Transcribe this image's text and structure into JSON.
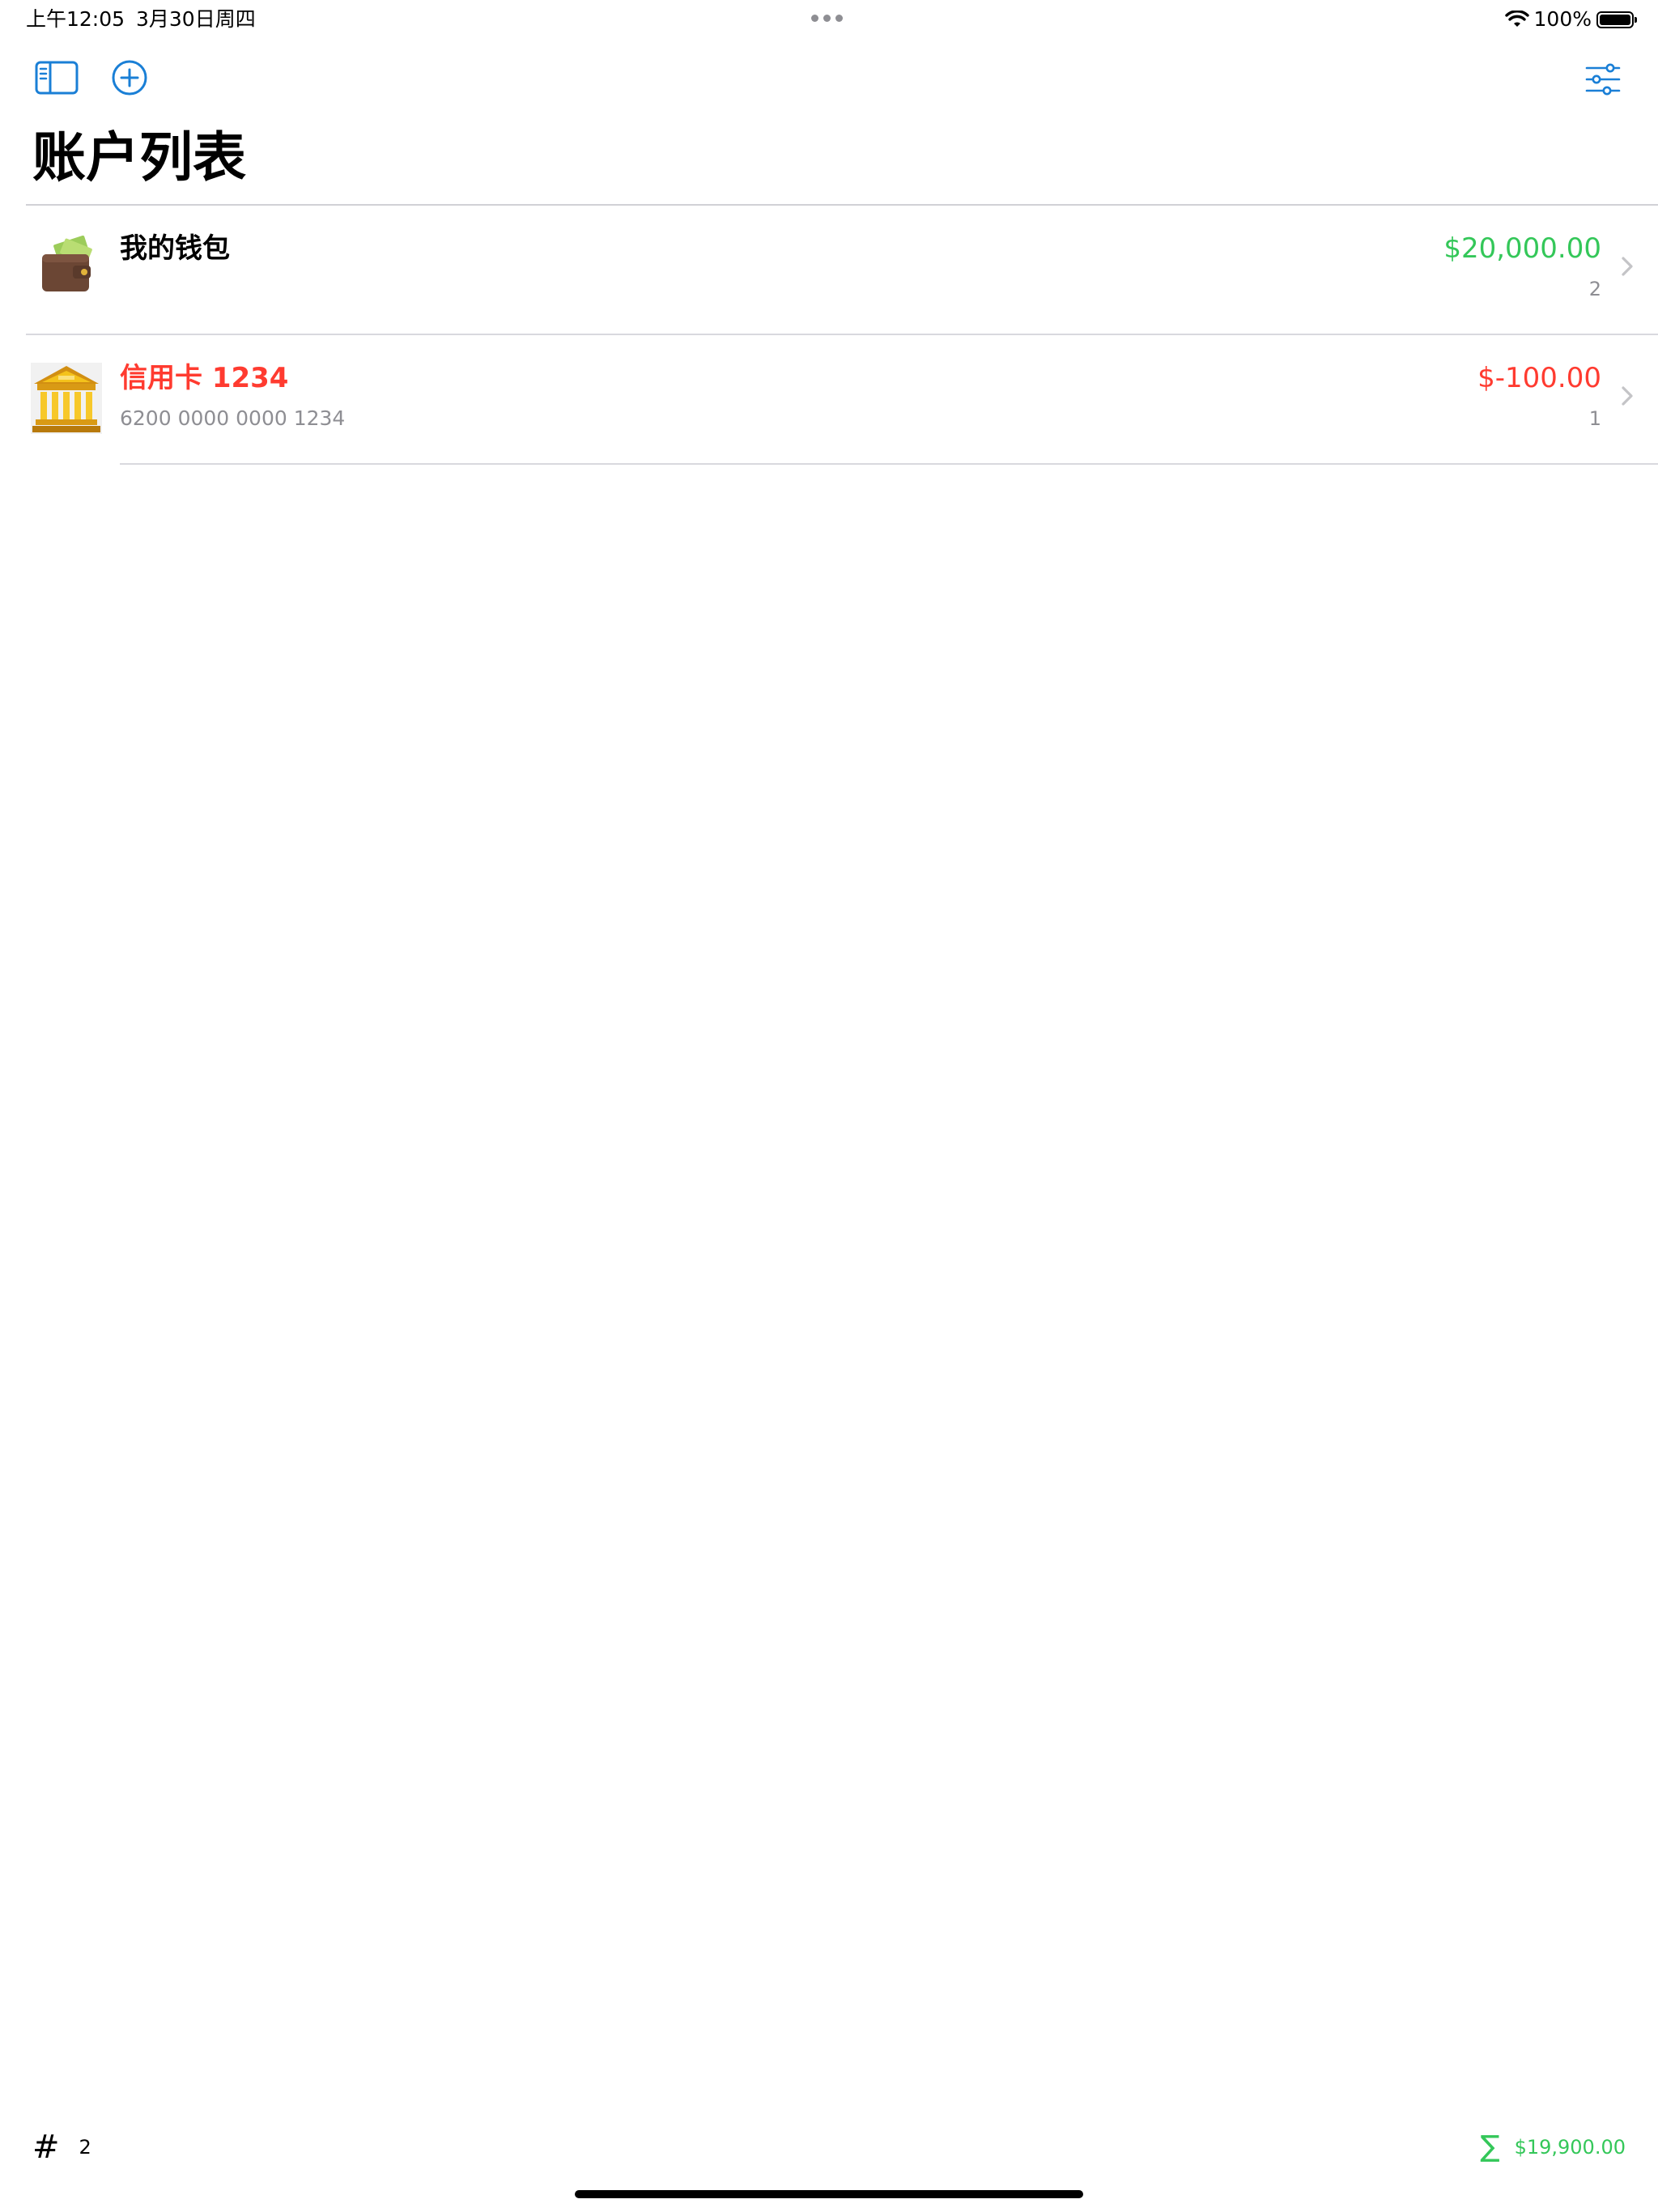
{
  "status_bar": {
    "time": "上午12:05",
    "date": "3月30日周四",
    "battery": "100%",
    "battery_level": 1.0
  },
  "colors": {
    "accent": "#1a7fd6",
    "positive": "#34c759",
    "negative": "#ff3b30",
    "secondary_text": "#8e8e93"
  },
  "nav": {
    "title": "账户列表",
    "left_buttons": [
      "sidebar-icon",
      "plus-circle-icon"
    ],
    "right_buttons": [
      "sliders-icon"
    ]
  },
  "accounts": [
    {
      "icon": "wallet-icon",
      "name": "我的钱包",
      "subtitle": "",
      "balance": "$20,000.00",
      "balance_status": "positive",
      "count": "2"
    },
    {
      "icon": "bank-icon",
      "name": "信用卡 1234",
      "subtitle": "6200 0000 0000 1234",
      "balance": "$-100.00",
      "balance_status": "negative",
      "count": "1"
    }
  ],
  "footer": {
    "count_icon": "hash-icon",
    "count": "2",
    "total_icon": "sigma-icon",
    "total": "$19,900.00"
  }
}
